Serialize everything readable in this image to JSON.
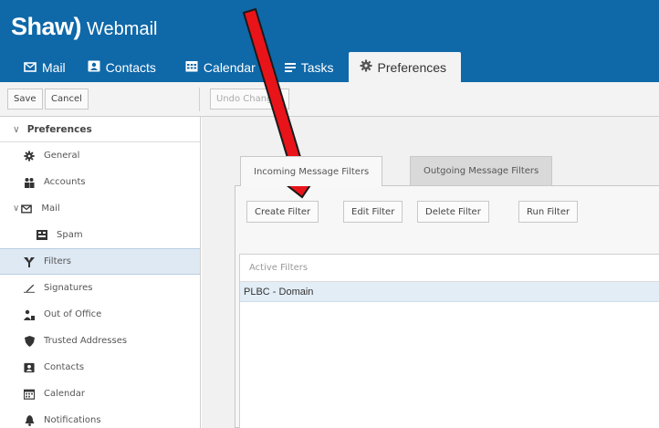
{
  "app": {
    "brand_name": "Shaw",
    "brand_product": "Webmail"
  },
  "nav_tabs": [
    {
      "label": "Mail",
      "icon": "envelope-icon"
    },
    {
      "label": "Contacts",
      "icon": "contact-card-icon"
    },
    {
      "label": "Calendar",
      "icon": "calendar-icon"
    },
    {
      "label": "Tasks",
      "icon": "tasks-icon"
    },
    {
      "label": "Preferences",
      "icon": "gear-icon",
      "active": true
    }
  ],
  "toolbar": {
    "save_label": "Save",
    "cancel_label": "Cancel",
    "undo_label": "Undo Changes"
  },
  "sidebar": {
    "header": "Preferences",
    "items": [
      {
        "label": "General",
        "icon": "gear-icon"
      },
      {
        "label": "Accounts",
        "icon": "accounts-icon"
      },
      {
        "label": "Mail",
        "icon": "envelope-icon"
      },
      {
        "label": "Spam",
        "icon": "spam-icon"
      },
      {
        "label": "Filters",
        "icon": "filter-icon",
        "selected": true
      },
      {
        "label": "Signatures",
        "icon": "signature-icon"
      },
      {
        "label": "Out of Office",
        "icon": "out-of-office-icon"
      },
      {
        "label": "Trusted Addresses",
        "icon": "shield-icon"
      },
      {
        "label": "Contacts",
        "icon": "contact-card-icon"
      },
      {
        "label": "Calendar",
        "icon": "calendar-icon"
      },
      {
        "label": "Notifications",
        "icon": "bell-icon"
      }
    ]
  },
  "filter_tabs": [
    {
      "label": "Incoming Message Filters",
      "active": true
    },
    {
      "label": "Outgoing Message Filters",
      "active": false
    }
  ],
  "filter_buttons": {
    "create": "Create Filter",
    "edit": "Edit Filter",
    "delete": "Delete Filter",
    "run": "Run Filter"
  },
  "filters_list": {
    "header": "Active Filters",
    "rows": [
      "PLBC - Domain"
    ]
  },
  "colors": {
    "brand_blue": "#0f68a8",
    "arrow_red": "#e8141a",
    "selection": "#dfe9f3"
  }
}
